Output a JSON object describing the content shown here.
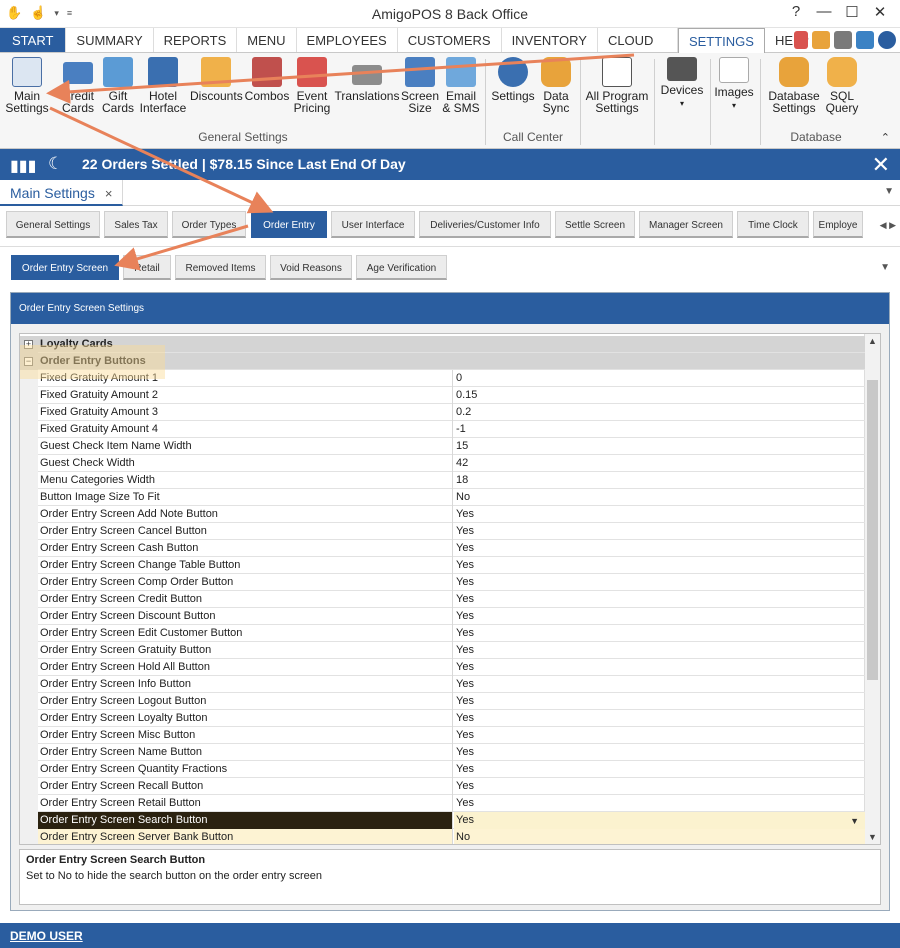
{
  "app": {
    "title": "AmigoPOS 8 Back Office"
  },
  "ribbon_tabs": [
    "START",
    "SUMMARY",
    "REPORTS",
    "MENU",
    "EMPLOYEES",
    "CUSTOMERS",
    "INVENTORY",
    "CLOUD",
    "SETTINGS",
    "HELP"
  ],
  "ribbon": {
    "general": [
      {
        "label1": "Main",
        "label2": "Settings"
      },
      {
        "label1": "Credit",
        "label2": "Cards"
      },
      {
        "label1": "Gift",
        "label2": "Cards"
      },
      {
        "label1": "Hotel",
        "label2": "Interface"
      },
      {
        "label1": "Discounts",
        "label2": ""
      },
      {
        "label1": "Combos",
        "label2": ""
      },
      {
        "label1": "Event",
        "label2": "Pricing"
      },
      {
        "label1": "Translations",
        "label2": ""
      },
      {
        "label1": "Screen",
        "label2": "Size"
      },
      {
        "label1": "Email",
        "label2": "& SMS"
      }
    ],
    "call_center": [
      {
        "label1": "Settings",
        "label2": ""
      },
      {
        "label1": "Data",
        "label2": "Sync"
      }
    ],
    "all_program": {
      "label1": "All Program",
      "label2": "Settings"
    },
    "devices": "Devices",
    "images": "Images",
    "database": [
      {
        "label1": "Database",
        "label2": "Settings"
      },
      {
        "label1": "SQL",
        "label2": "Query"
      }
    ],
    "groups": {
      "general": "General Settings",
      "call_center": "Call Center",
      "database": "Database"
    }
  },
  "status": {
    "text": "22 Orders Settled | $78.15 Since Last End Of Day"
  },
  "doc_tab": {
    "label": "Main Settings",
    "close": "×"
  },
  "settings_tabs": [
    "General Settings",
    "Sales Tax",
    "Order Types",
    "Order Entry",
    "User Interface",
    "Deliveries/Customer Info",
    "Settle Screen",
    "Manager Screen",
    "Time Clock",
    "Employe"
  ],
  "sub_tabs": [
    "Order Entry Screen",
    "Retail",
    "Removed Items",
    "Void Reasons",
    "Age Verification"
  ],
  "panel": {
    "title": "Order Entry Screen Settings"
  },
  "grid": {
    "rows": [
      {
        "name": "Loyalty Cards",
        "value": "",
        "cat": true,
        "exp": "+"
      },
      {
        "name": "Order Entry Buttons",
        "value": "",
        "cat": true,
        "exp": "−"
      },
      {
        "name": "Fixed Gratuity Amount 1",
        "value": "0"
      },
      {
        "name": "Fixed Gratuity Amount 2",
        "value": "0.15"
      },
      {
        "name": "Fixed Gratuity Amount 3",
        "value": "0.2"
      },
      {
        "name": "Fixed Gratuity Amount 4",
        "value": "-1"
      },
      {
        "name": "Guest Check Item Name Width",
        "value": "15"
      },
      {
        "name": "Guest Check Width",
        "value": "42"
      },
      {
        "name": "Menu Categories Width",
        "value": "18"
      },
      {
        "name": "Button Image Size To Fit",
        "value": "No"
      },
      {
        "name": "Order Entry Screen Add Note Button",
        "value": "Yes"
      },
      {
        "name": "Order Entry Screen Cancel Button",
        "value": "Yes"
      },
      {
        "name": "Order Entry Screen Cash Button",
        "value": "Yes"
      },
      {
        "name": "Order Entry Screen Change Table Button",
        "value": "Yes"
      },
      {
        "name": "Order Entry Screen Comp Order Button",
        "value": "Yes"
      },
      {
        "name": "Order Entry Screen Credit Button",
        "value": "Yes"
      },
      {
        "name": "Order Entry Screen Discount Button",
        "value": "Yes"
      },
      {
        "name": "Order Entry Screen Edit Customer Button",
        "value": "Yes"
      },
      {
        "name": "Order Entry Screen Gratuity Button",
        "value": "Yes"
      },
      {
        "name": "Order Entry Screen Hold All Button",
        "value": "Yes"
      },
      {
        "name": "Order Entry Screen Info Button",
        "value": "Yes"
      },
      {
        "name": "Order Entry Screen Logout Button",
        "value": "Yes"
      },
      {
        "name": "Order Entry Screen Loyalty Button",
        "value": "Yes"
      },
      {
        "name": "Order Entry Screen Misc Button",
        "value": "Yes"
      },
      {
        "name": "Order Entry Screen Name Button",
        "value": "Yes"
      },
      {
        "name": "Order Entry Screen Quantity Fractions",
        "value": "Yes"
      },
      {
        "name": "Order Entry Screen Recall Button",
        "value": "Yes"
      },
      {
        "name": "Order Entry Screen Retail Button",
        "value": "Yes"
      },
      {
        "name": "Order Entry Screen Search Button",
        "value": "Yes",
        "sel": true
      },
      {
        "name": "Order Entry Screen Server Bank Button",
        "value": "No",
        "hl": true
      }
    ]
  },
  "description": {
    "title": "Order Entry Screen Search Button",
    "text": "Set to No to hide the search button on the order entry screen"
  },
  "footer": {
    "user": "DEMO USER"
  }
}
